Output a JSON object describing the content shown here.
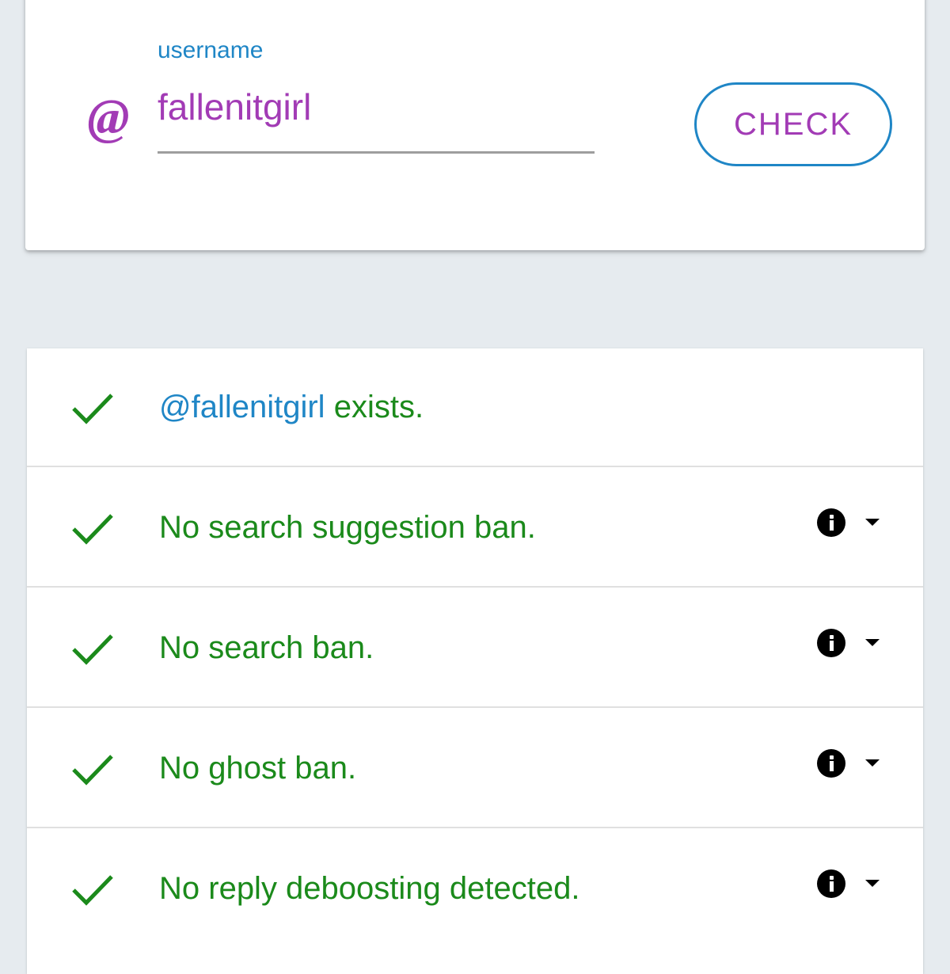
{
  "search": {
    "label": "username",
    "at_symbol": "@",
    "value": "fallenitgirl",
    "button_label": "CHECK"
  },
  "results": [
    {
      "handle": "@fallenitgirl",
      "text": " exists.",
      "status": "pass",
      "has_info": false
    },
    {
      "text": "No search suggestion ban.",
      "status": "pass",
      "has_info": true
    },
    {
      "text": "No search ban.",
      "status": "pass",
      "has_info": true
    },
    {
      "text": "No ghost ban.",
      "status": "pass",
      "has_info": true
    },
    {
      "text": "No reply deboosting detected.",
      "status": "pass",
      "has_info": true
    }
  ],
  "colors": {
    "accent_blue": "#1f86c6",
    "accent_purple": "#a23bb5",
    "success_green": "#1b8a1b",
    "background": "#e6ebef"
  },
  "icons": {
    "input_prefix": "at-sign-icon",
    "result_status": "checkmark-icon",
    "info": "info-icon",
    "expand": "dropdown-arrow-icon"
  }
}
